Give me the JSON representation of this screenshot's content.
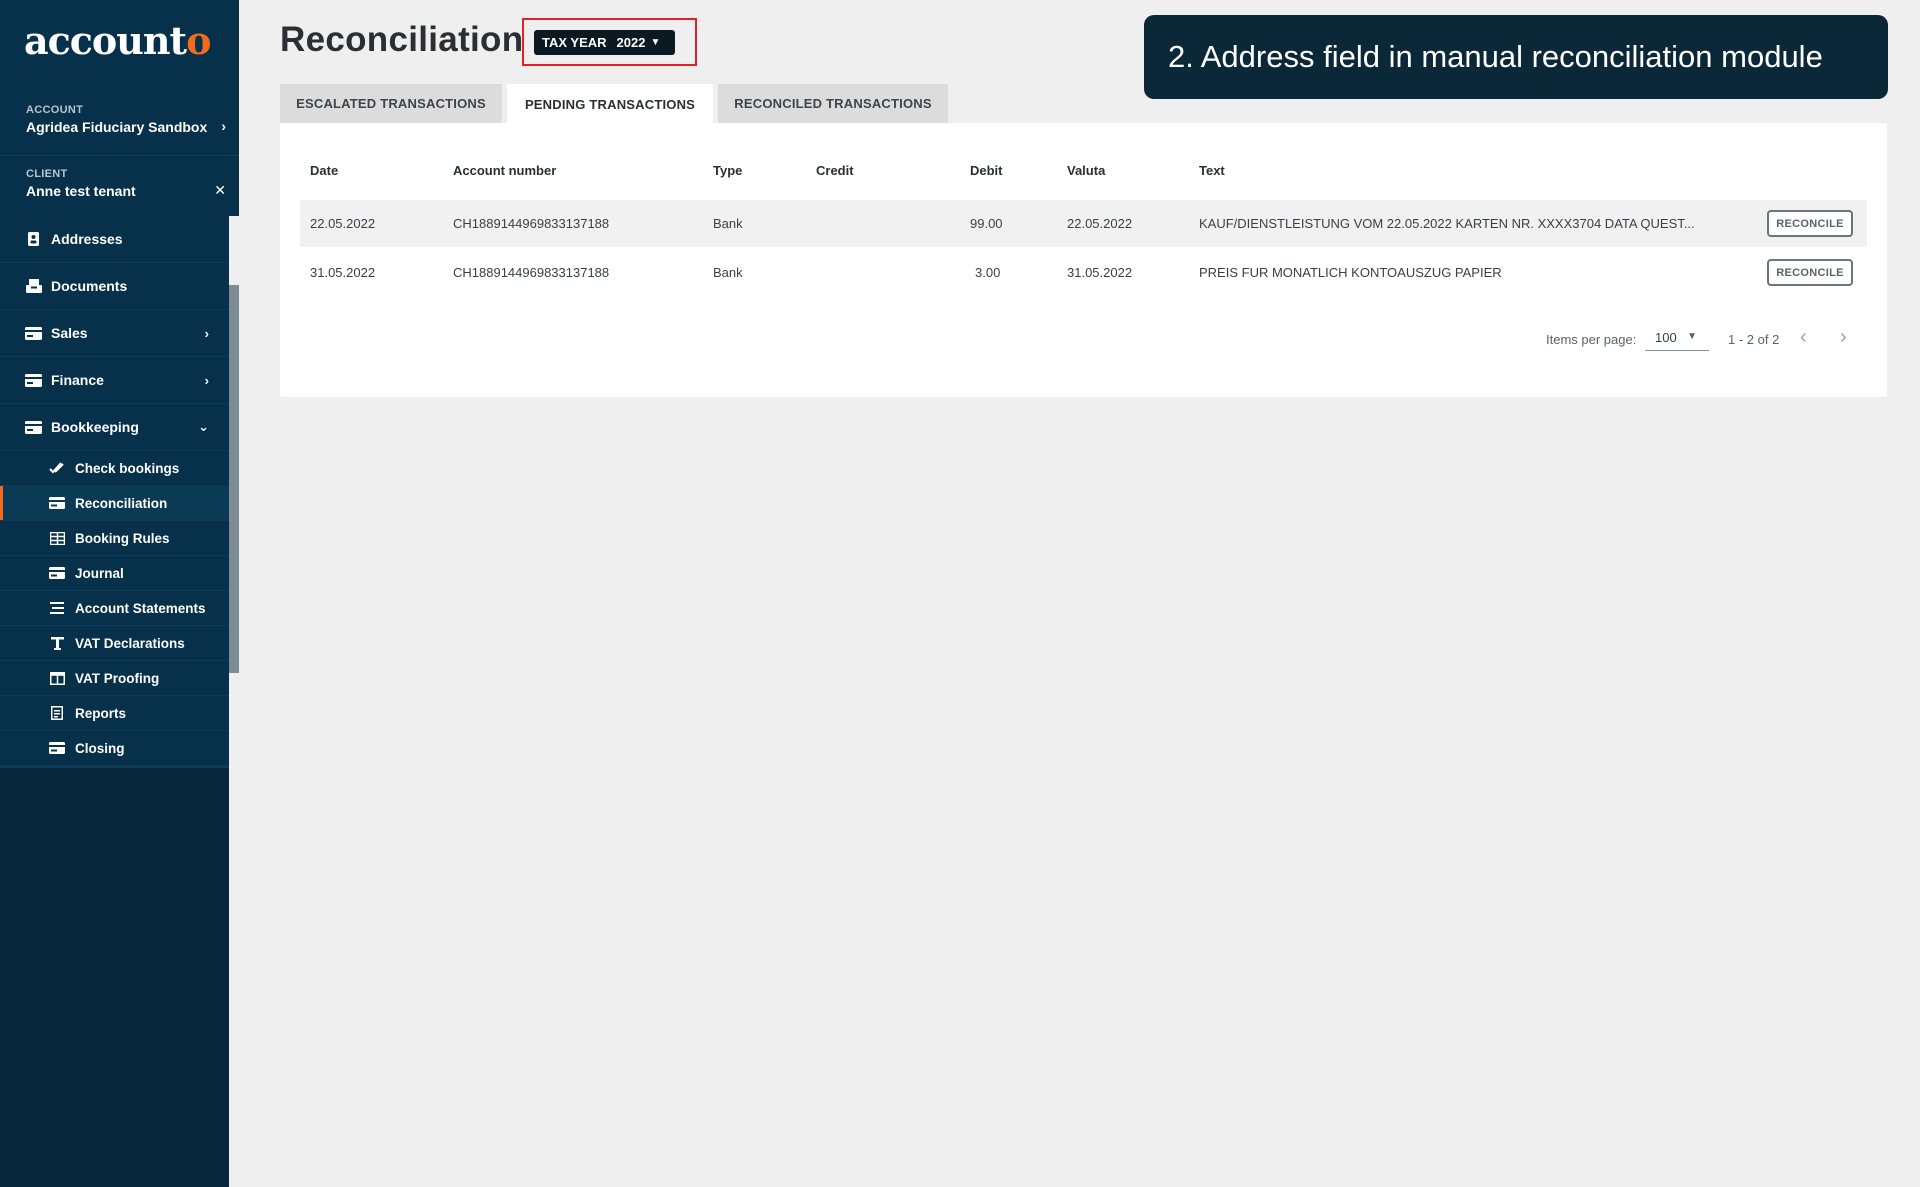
{
  "brand": {
    "name_main": "account",
    "name_accent": "o"
  },
  "context": {
    "account_label": "ACCOUNT",
    "account_value": "Agridea Fiduciary Sandbox",
    "client_label": "CLIENT",
    "client_value": "Anne test tenant"
  },
  "nav": {
    "items": [
      {
        "label": "Addresses",
        "icon": "address-book-icon"
      },
      {
        "label": "Documents",
        "icon": "inbox-icon"
      },
      {
        "label": "Sales",
        "icon": "card-icon",
        "chevron": "›"
      },
      {
        "label": "Finance",
        "icon": "card-icon",
        "chevron": "›"
      },
      {
        "label": "Bookkeeping",
        "icon": "card-icon",
        "chevron": "⌄"
      }
    ],
    "sub_items": [
      {
        "label": "Check bookings",
        "icon": "double-check-icon"
      },
      {
        "label": "Reconciliation",
        "icon": "card-icon",
        "active": true
      },
      {
        "label": "Booking Rules",
        "icon": "table-icon"
      },
      {
        "label": "Journal",
        "icon": "card-icon"
      },
      {
        "label": "Account Statements",
        "icon": "list-icon"
      },
      {
        "label": "VAT Declarations",
        "icon": "text-icon"
      },
      {
        "label": "VAT Proofing",
        "icon": "columns-icon"
      },
      {
        "label": "Reports",
        "icon": "report-icon"
      },
      {
        "label": "Closing",
        "icon": "card-icon"
      }
    ]
  },
  "header": {
    "title": "Reconciliation",
    "tax_year_label": "TAX YEAR",
    "tax_year_value": "2022"
  },
  "callout": {
    "text": "2. Address field in manual reconciliation module"
  },
  "tabs": [
    {
      "label": "ESCALATED TRANSACTIONS"
    },
    {
      "label": "PENDING TRANSACTIONS",
      "active": true
    },
    {
      "label": "RECONCILED TRANSACTIONS"
    }
  ],
  "table": {
    "columns": [
      "Date",
      "Account number",
      "Type",
      "Credit",
      "Debit",
      "Valuta",
      "Text"
    ],
    "rows": [
      {
        "date": "22.05.2022",
        "account": "CH1889144969833137188",
        "type": "Bank",
        "credit": "",
        "debit": "99.00",
        "valuta": "22.05.2022",
        "text": "KAUF/DIENSTLEISTUNG VOM 22.05.2022 KARTEN NR. XXXX3704 DATA QUEST...",
        "action": "RECONCILE"
      },
      {
        "date": "31.05.2022",
        "account": "CH1889144969833137188",
        "type": "Bank",
        "credit": "",
        "debit": "3.00",
        "valuta": "31.05.2022",
        "text": "PREIS FUR MONATLICH KONTOAUSZUG PAPIER",
        "action": "RECONCILE"
      }
    ]
  },
  "pagination": {
    "items_per_page_label": "Items per page:",
    "items_per_page_value": "100",
    "range": "1 - 2 of 2",
    "prev": "‹",
    "next": "›"
  }
}
